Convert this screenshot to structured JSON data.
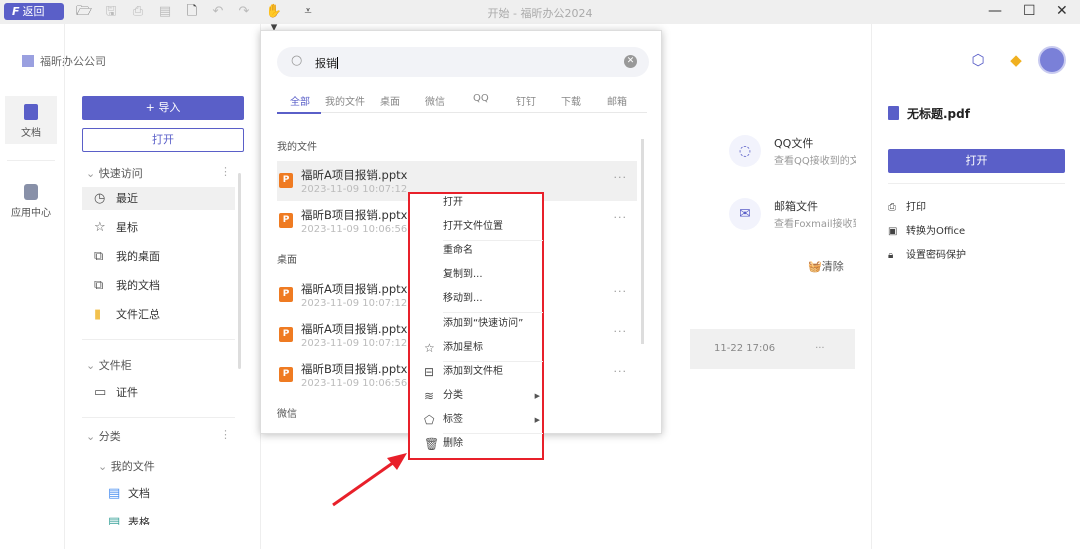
{
  "app": {
    "title": "开始 - 福昕办公2024",
    "back_label": "返回",
    "brand_colors": {
      "accent": "#5a5fc8",
      "highlight": "#e8202a"
    }
  },
  "toolbar": {
    "icons": [
      "open-folder-icon",
      "save-icon",
      "print-icon",
      "export-icon",
      "new-file-icon",
      "undo-icon",
      "redo-icon",
      "hand-tool-icon",
      "dropdown-icon"
    ]
  },
  "header": {
    "company": "福昕办公公司"
  },
  "rail": {
    "items": [
      {
        "label": "文档"
      },
      {
        "label": "应用中心"
      }
    ]
  },
  "sidebar": {
    "import_label": "+ 导入",
    "open_label": "打开",
    "quick_access": {
      "title": "快速访问",
      "items": [
        {
          "label": "最近",
          "icon": "clock-icon"
        },
        {
          "label": "星标",
          "icon": "star-icon"
        },
        {
          "label": "我的桌面",
          "icon": "desktop-icon"
        },
        {
          "label": "我的文档",
          "icon": "documents-icon"
        },
        {
          "label": "文件汇总",
          "icon": "folder-icon"
        }
      ]
    },
    "cabinet": {
      "title": "文件柜",
      "items": [
        {
          "label": "证件",
          "icon": "id-card-icon"
        }
      ]
    },
    "category": {
      "title": "分类",
      "sub": "我的文件",
      "items": [
        {
          "label": "文档"
        },
        {
          "label": "表格"
        }
      ]
    }
  },
  "main": {
    "cards": [
      {
        "title": "QQ文件",
        "desc": "查看QQ接收到的文"
      },
      {
        "title": "邮箱文件",
        "desc": "查看Foxmail接收到"
      }
    ],
    "clear_label": "清除",
    "recent_row": {
      "time": "11-22 17:06"
    }
  },
  "right_panel": {
    "file": "无标题.pdf",
    "open_label": "打开",
    "actions": [
      {
        "label": "打印",
        "icon": "printer-icon"
      },
      {
        "label": "转换为Office",
        "icon": "word-icon"
      },
      {
        "label": "设置密码保护",
        "icon": "lock-icon"
      }
    ]
  },
  "search": {
    "query": "报销",
    "tabs": [
      "全部",
      "我的文件",
      "桌面",
      "微信",
      "QQ",
      "钉钉",
      "下载",
      "邮箱"
    ],
    "active_tab": "全部",
    "groups": [
      {
        "title": "我的文件",
        "files": [
          {
            "name": "福昕A项目报销.pptx",
            "date": "2023-11-09 10:07:12"
          },
          {
            "name": "福昕B项目报销.pptx",
            "date": "2023-11-09 10:06:56"
          }
        ]
      },
      {
        "title": "桌面",
        "files": [
          {
            "name": "福昕A项目报销.pptx",
            "date": "2023-11-09 10:07:12"
          },
          {
            "name": "福昕A项目报销.pptx",
            "date": "2023-11-09 10:07:12"
          },
          {
            "name": "福昕B项目报销.pptx",
            "date": "2023-11-09 10:06:56"
          }
        ]
      },
      {
        "title": "微信",
        "files": []
      }
    ]
  },
  "context_menu": {
    "items": [
      "打开",
      "打开文件位置",
      "重命名",
      "复制到...",
      "移动到...",
      "添加到“快速访问”",
      "添加星标",
      "添加到文件柜",
      "分类",
      "标签",
      "删除"
    ]
  }
}
